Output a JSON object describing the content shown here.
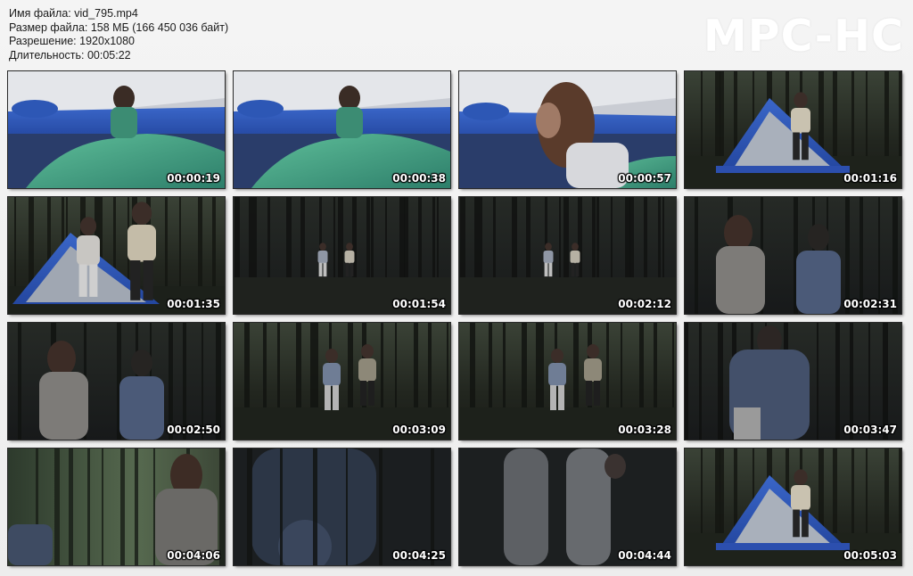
{
  "file_info": {
    "filename": "Имя файла: vid_795.mp4",
    "filesize": "Размер файла: 158 МБ (166 450 036 байт)",
    "resolution": "Разрешение: 1920x1080",
    "duration": "Длительность: 00:05:22"
  },
  "logo": "MPC-HC",
  "thumbnails": [
    {
      "time": "00:00:19",
      "scene": "tent-inside-1"
    },
    {
      "time": "00:00:38",
      "scene": "tent-inside-1"
    },
    {
      "time": "00:00:57",
      "scene": "tent-inside-2"
    },
    {
      "time": "00:01:16",
      "scene": "forest-tent-person"
    },
    {
      "time": "00:01:35",
      "scene": "forest-tent-two"
    },
    {
      "time": "00:01:54",
      "scene": "forest-dark-far"
    },
    {
      "time": "00:02:12",
      "scene": "forest-dark-far"
    },
    {
      "time": "00:02:31",
      "scene": "forest-two-close"
    },
    {
      "time": "00:02:50",
      "scene": "forest-two-close"
    },
    {
      "time": "00:03:09",
      "scene": "forest-two-mid"
    },
    {
      "time": "00:03:28",
      "scene": "forest-two-mid"
    },
    {
      "time": "00:03:47",
      "scene": "forest-one-close"
    },
    {
      "time": "00:04:06",
      "scene": "forest-green-close"
    },
    {
      "time": "00:04:25",
      "scene": "very-close-dark"
    },
    {
      "time": "00:04:44",
      "scene": "legs-close"
    },
    {
      "time": "00:05:03",
      "scene": "forest-tent-person"
    }
  ]
}
